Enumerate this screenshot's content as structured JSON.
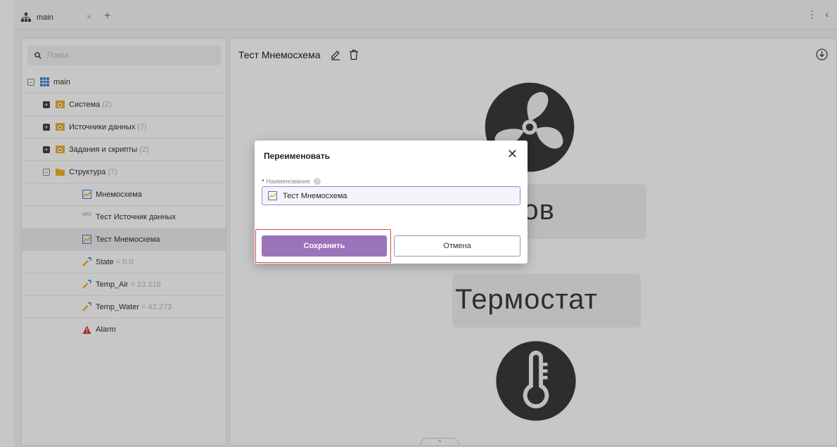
{
  "tab": {
    "label": "main",
    "close": "×",
    "add": "+"
  },
  "tabbar_right": {
    "menu": "⋮",
    "back": "‹"
  },
  "search": {
    "placeholder": "Поиск"
  },
  "tree": {
    "root": {
      "label": "main"
    },
    "items": [
      {
        "label": "Система",
        "count": "(2)"
      },
      {
        "label": "Источники данных",
        "count": "(7)"
      },
      {
        "label": "Задания и скрипты",
        "count": "(2)"
      },
      {
        "label": "Структура",
        "count": "(7)"
      }
    ],
    "children": [
      {
        "label": "Мнемосхема"
      },
      {
        "label": "Тест Источник данных",
        "tag": "OPC"
      },
      {
        "label": "Тест Мнемосхема"
      },
      {
        "label": "State",
        "value": "= 0.0"
      },
      {
        "label": "Temp_Air",
        "value": "= 23.218"
      },
      {
        "label": "Temp_Water",
        "value": "= 42.273"
      },
      {
        "label": "Alarm"
      }
    ]
  },
  "main": {
    "title": "Тест Мнемосхема",
    "canvas": {
      "partial_label": "анов",
      "thermostat_label": "Термостат"
    },
    "scroll_handle": "^"
  },
  "dialog": {
    "title": "Переименовать",
    "close": "✕",
    "field_label": "Наименование",
    "required_mark": "•",
    "help": "?",
    "value": "Тест Мнемосхема",
    "save": "Сохранить",
    "cancel": "Отмена"
  },
  "colors": {
    "accent": "#9a74b8",
    "highlight": "#e04848",
    "folder_yellow": "#f2b320",
    "alarm_red": "#d9383a"
  }
}
